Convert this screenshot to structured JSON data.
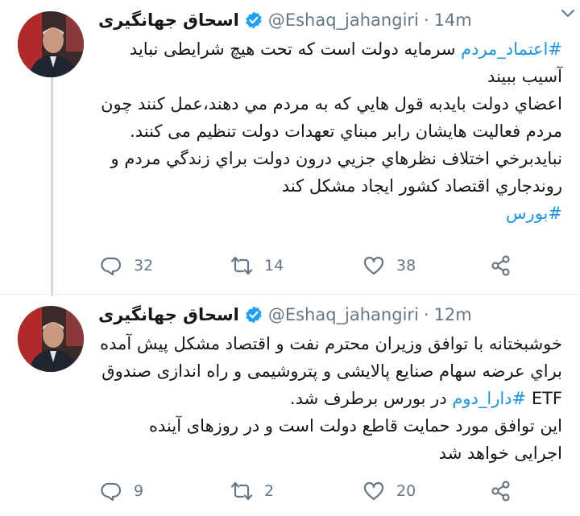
{
  "tweets": [
    {
      "author_name": "اسحاق جهانگیری",
      "handle": "@Eshaq_jahangiri",
      "separator": "·",
      "time": "14m",
      "lines": [
        [
          {
            "text": "#اعتماد_مردم",
            "tag": true
          },
          {
            "text": " سرمایه دولت است که تحت هیچ شرایطی نباید آسیب ببیند",
            "tag": false
          }
        ],
        [
          {
            "text": "اعضاي دولت بايدبه قول هايي كه به مردم مي دهند،عمل كنند چون مردم فعاليت هايشان رابر مبناي تعهدات دولت تنظيم مى كنند.",
            "tag": false
          }
        ],
        [
          {
            "text": "نبايدبرخي اختلاف نظرهاي جزيي درون دولت براي زندگي مردم و روندجاري اقتصاد كشور ايجاد مشكل كند",
            "tag": false
          }
        ],
        [
          {
            "text": "#بورس",
            "tag": true
          }
        ]
      ],
      "replies": "32",
      "retweets": "14",
      "likes": "38"
    },
    {
      "author_name": "اسحاق جهانگیری",
      "handle": "@Eshaq_jahangiri",
      "separator": "·",
      "time": "12m",
      "lines": [
        [
          {
            "text": "خوشبختانه با توافق وزيران محترم نفت و اقتصاد مشكل پيش آمده براي عرضه سهام صنايع پالايشى و پتروشيمى و راه اندازى صندوق ETF ",
            "tag": false
          },
          {
            "text": "#دارا_دوم",
            "tag": true
          },
          {
            "text": " در بورس برطرف شد.",
            "tag": false
          }
        ],
        [
          {
            "text": "اين توافق مورد حمايت قاطع دولت است و در روزهاى آينده اجرايى خواهد شد",
            "tag": false
          }
        ]
      ],
      "replies": "9",
      "retweets": "2",
      "likes": "20"
    }
  ],
  "colors": {
    "hashtag": "#1b95e0",
    "verified": "#1da1f2",
    "muted": "#657786"
  },
  "icons": [
    "verified-badge-icon",
    "chevron-down-icon",
    "reply-icon",
    "retweet-icon",
    "like-icon",
    "share-icon"
  ]
}
